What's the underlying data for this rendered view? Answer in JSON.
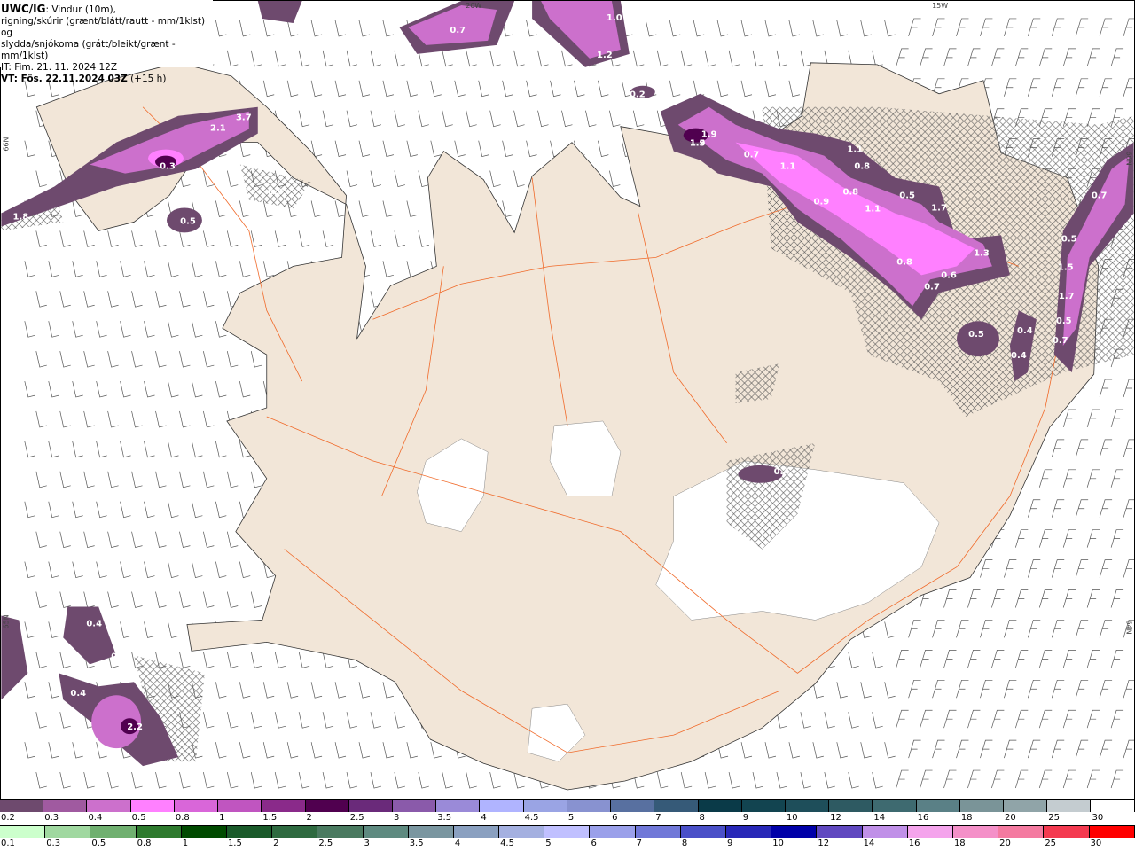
{
  "header": {
    "model": "UWC/IG",
    "line1": ": Vindur (10m),",
    "line2": "rigning/skúrir (grænt/blátt/rautt - mm/1klst) og",
    "line3": "slydda/snjókoma (grátt/bleikt/grænt - mm/1klst)",
    "it": "IT: Fim. 21. 11. 2024 12Z",
    "vt_bold": "VT: Fös. 22.11.2024 03Z",
    "vt_lead": " (+15 h)"
  },
  "map": {
    "grid_labels": [
      "20W",
      "15W",
      "66N",
      "65N",
      "66N",
      "64N"
    ],
    "colors": {
      "land": "#f2e6d8",
      "sea": "#ffffff",
      "roads": "#f06a2a",
      "precip_light": "#6e4a6e",
      "precip_mid": "#cc70cc",
      "precip_high": "#ff80ff"
    },
    "precip_values": [
      "1.0",
      "0.7",
      "1.2",
      "0.2",
      "1.9",
      "2.1",
      "3.7",
      "0.3",
      "0.9",
      "0.5",
      "1.8",
      "1.9",
      "1.5",
      "0.7",
      "1.1",
      "1.1",
      "0.8",
      "0.8",
      "1.1",
      "0.9",
      "0.5",
      "1.7",
      "1.3",
      "0.8",
      "0.6",
      "0.7",
      "0.5",
      "0.4",
      "0.4",
      "0.7",
      "0.5",
      "1.5",
      "1.7",
      "0.5",
      "0.7",
      "0.4",
      "0.4",
      "0.5",
      "0.4",
      "2.2"
    ]
  },
  "legend": {
    "snow": {
      "labels": [
        "0.2",
        "0.3",
        "0.4",
        "0.5",
        "0.8",
        "1",
        "1.5",
        "2",
        "2.5",
        "3",
        "3.5",
        "4",
        "4.5",
        "5",
        "6",
        "7",
        "8",
        "9",
        "10",
        "12",
        "14",
        "16",
        "18",
        "20",
        "25",
        "30"
      ],
      "colors": [
        "#6e4a6e",
        "#a05aa0",
        "#cc70cc",
        "#ff80ff",
        "#d966d9",
        "#c055c0",
        "#8a2a8a",
        "#50004f",
        "#6a2a7a",
        "#8a5aaa",
        "#9a8ad8",
        "#b0b4ff",
        "#9aa4e4",
        "#8892d0",
        "#5870a0",
        "#365a78",
        "#0a3a48",
        "#124450",
        "#1e4e5a",
        "#2e5a62",
        "#3e6a70",
        "#5a8086",
        "#7a9498",
        "#90a4a8",
        "#c4ccd0",
        "#ffffff"
      ]
    },
    "rain": {
      "labels": [
        "0.1",
        "0.3",
        "0.5",
        "0.8",
        "1",
        "1.5",
        "2",
        "2.5",
        "3",
        "3.5",
        "4",
        "4.5",
        "5",
        "6",
        "7",
        "8",
        "9",
        "10",
        "12",
        "14",
        "16",
        "18",
        "20",
        "25",
        "30"
      ],
      "colors": [
        "#ccffcc",
        "#a0d8a0",
        "#70b070",
        "#2e7a2e",
        "#004a00",
        "#1a5a2a",
        "#2e6a40",
        "#4a7a60",
        "#5e8a80",
        "#7a96a0",
        "#8aa0c0",
        "#a4b0e0",
        "#c0c0ff",
        "#9aa0ea",
        "#7078d8",
        "#4a50c8",
        "#2828b8",
        "#0000a8",
        "#6048c0",
        "#c090e8",
        "#f4a4ec",
        "#f490c8",
        "#f47aa0",
        "#f43a50",
        "#ff0000"
      ]
    }
  }
}
